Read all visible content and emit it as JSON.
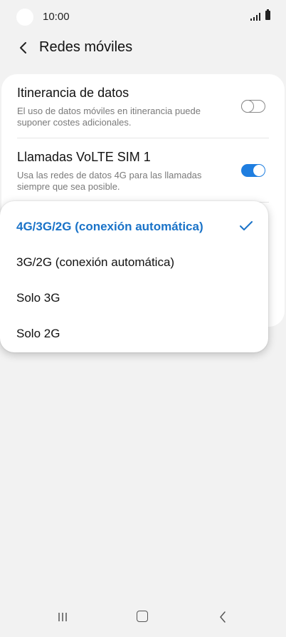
{
  "status_bar": {
    "time": "10:00",
    "icons": [
      "camera-icon",
      "signal-icon",
      "battery-icon"
    ]
  },
  "header": {
    "title": "Redes móviles",
    "back_icon": "back-arrow-icon"
  },
  "settings": [
    {
      "title": "Itinerancia de datos",
      "description": "El uso de datos móviles en itinerancia puede suponer costes adicionales.",
      "toggle_on": false
    },
    {
      "title": "Llamadas VoLTE SIM 1",
      "description": "Usa las redes de datos 4G para las llamadas siempre que sea posible.",
      "toggle_on": true
    }
  ],
  "network_mode_options": [
    {
      "label": "4G/3G/2G (conexión automática)",
      "selected": true
    },
    {
      "label": "3G/2G (conexión automática)",
      "selected": false
    },
    {
      "label": "Solo 3G",
      "selected": false
    },
    {
      "label": "Solo 2G",
      "selected": false
    }
  ],
  "colors": {
    "accent": "#1f7ee0",
    "selected_text": "#1a73c8",
    "background": "#f2f2f2",
    "card": "#ffffff",
    "secondary_text": "#7a7a7a"
  },
  "nav_bar": {
    "icons": [
      "recents-icon",
      "home-icon",
      "back-icon"
    ]
  }
}
